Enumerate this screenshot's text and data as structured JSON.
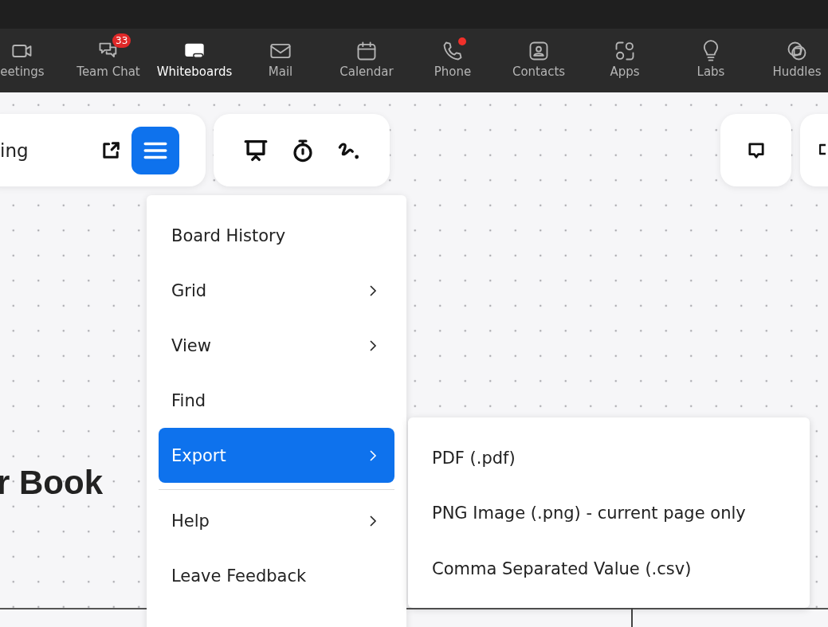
{
  "nav": {
    "items": [
      {
        "label": "eetings",
        "selected": false
      },
      {
        "label": "Team Chat",
        "selected": false,
        "badge": "33"
      },
      {
        "label": "Whiteboards",
        "selected": true
      },
      {
        "label": "Mail",
        "selected": false
      },
      {
        "label": "Calendar",
        "selected": false
      },
      {
        "label": "Phone",
        "selected": false,
        "dot": true
      },
      {
        "label": "Contacts",
        "selected": false
      },
      {
        "label": "Apps",
        "selected": false
      },
      {
        "label": "Labs",
        "selected": false
      },
      {
        "label": "Huddles",
        "selected": false
      }
    ]
  },
  "board": {
    "title": "ing",
    "canvas_text": "r Book"
  },
  "menu": {
    "items": [
      {
        "label": "Board History",
        "submenu": false,
        "selected": false
      },
      {
        "label": "Grid",
        "submenu": true,
        "selected": false
      },
      {
        "label": "View",
        "submenu": true,
        "selected": false
      },
      {
        "label": "Find",
        "submenu": false,
        "selected": false
      },
      {
        "label": "Export",
        "submenu": true,
        "selected": true
      },
      {
        "label": "Help",
        "submenu": true,
        "selected": false
      },
      {
        "label": "Leave Feedback",
        "submenu": false,
        "selected": false
      }
    ]
  },
  "submenu": {
    "items": [
      {
        "label": "PDF (.pdf)"
      },
      {
        "label": "PNG Image (.png) - current page only"
      },
      {
        "label": "Comma Separated Value (.csv)"
      }
    ]
  }
}
